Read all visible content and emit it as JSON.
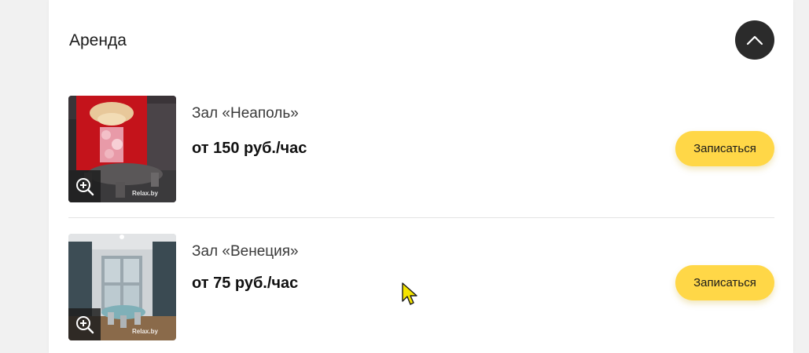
{
  "section": {
    "title": "Аренда",
    "collapse_icon": "chevron-up-icon"
  },
  "halls": [
    {
      "name": "Зал «Неаполь»",
      "price": "от 150 руб./час",
      "button_label": "Записаться",
      "watermark": "Relax.by"
    },
    {
      "name": "Зал «Венеция»",
      "price": "от 75 руб./час",
      "button_label": "Записаться",
      "watermark": "Relax.by"
    }
  ],
  "colors": {
    "accent": "#ffd747",
    "dark_button": "#2b2b2b",
    "background": "#f1f1f1"
  }
}
